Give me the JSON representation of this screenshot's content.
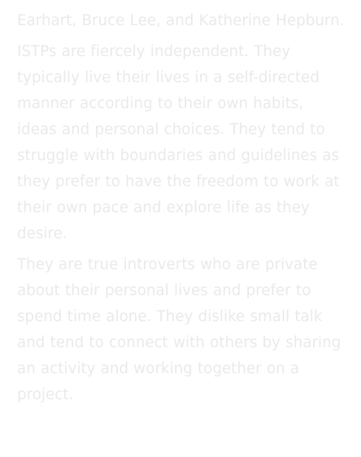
{
  "document": {
    "paragraphs": [
      "Earhart, Bruce Lee, and Katherine Hepburn.",
      "ISTPs are fiercely independent. They typically live their lives in a self-directed manner according to their own habits, ideas and personal choices. They tend to struggle with boundaries and guidelines as they prefer to have the freedom to work at their own pace and explore life as they desire.",
      "They are true introverts who are private about their personal lives and prefer to spend time alone. They dislike small talk and tend to connect with others by sharing an activity and working together on a project."
    ]
  },
  "colors": {
    "text": "#eaeaea",
    "background": "#ffffff"
  }
}
